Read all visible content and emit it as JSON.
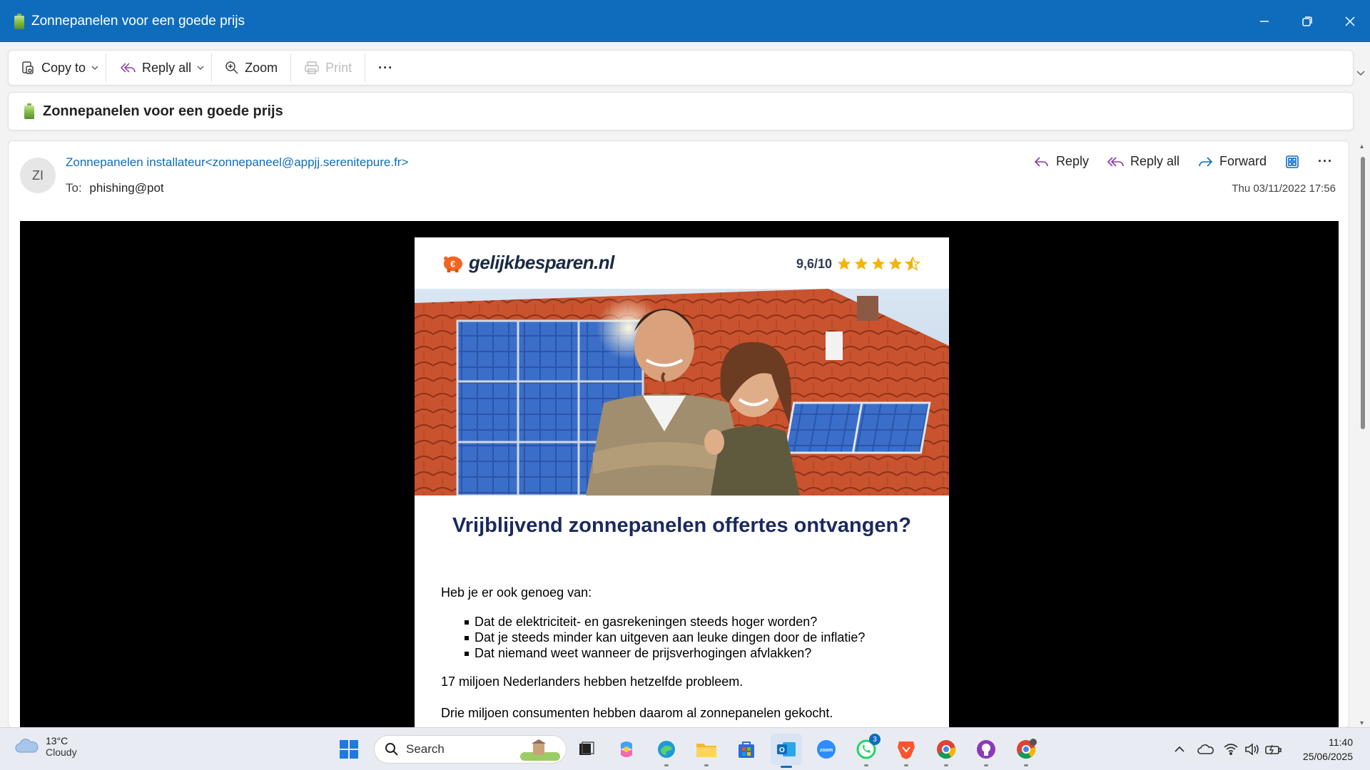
{
  "window": {
    "title": "Zonnepanelen voor een goede prijs"
  },
  "toolbar": {
    "copy_to": "Copy to",
    "reply_all": "Reply all",
    "zoom": "Zoom",
    "print": "Print",
    "more": "···"
  },
  "subject": "Zonnepanelen voor een goede prijs",
  "message": {
    "avatar_initials": "ZI",
    "sender": "Zonnepanelen installateur<zonnepaneel@appjj.serenitepure.fr>",
    "to_label": "To:",
    "to_value": "phishing@pot",
    "date": "Thu 03/11/2022 17:56",
    "actions": {
      "reply": "Reply",
      "reply_all": "Reply all",
      "forward": "Forward",
      "more": "···"
    }
  },
  "email": {
    "brand": "gelijkbesparen",
    "brand_tld": ".nl",
    "rating": "9,6/10",
    "stars": 4.5,
    "headline": "Vrijblijvend zonnepanelen offertes ontvangen?",
    "intro": "Heb je er ook genoeg van:",
    "bullets": [
      "Dat de elektriciteit- en gasrekeningen steeds hoger worden?",
      "Dat je steeds minder kan uitgeven aan leuke dingen door de inflatie?",
      "Dat niemand weet wanneer de prijsverhogingen afvlakken?"
    ],
    "para1": "17 miljoen Nederlanders hebben hetzelfde probleem.",
    "para2": "Drie miljoen consumenten hebben daarom al zonnepanelen gekocht."
  },
  "taskbar": {
    "weather_temp": "13°C",
    "weather_cond": "Cloudy",
    "search_label": "Search",
    "outlook_badge": "3",
    "time": "11:40",
    "date": "25/06/2025"
  },
  "colors": {
    "titlebar": "#0f6cbd",
    "link": "#0f6cbd",
    "headline": "#1a2a5e",
    "star": "#f5b301"
  }
}
